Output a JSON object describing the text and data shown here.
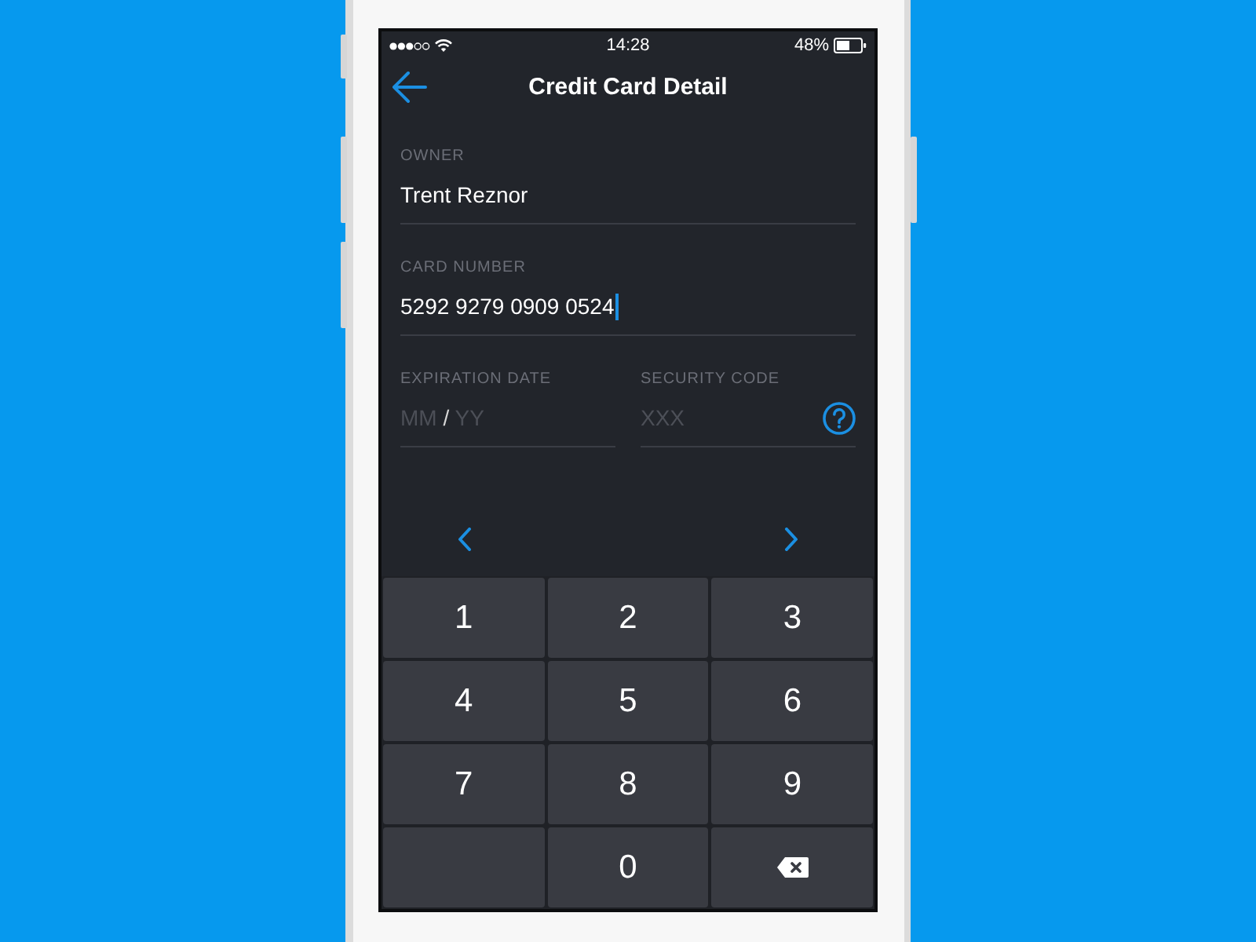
{
  "status_bar": {
    "time": "14:28",
    "battery": "48%"
  },
  "nav_bar": {
    "title": "Credit Card Detail"
  },
  "fields": [
    {
      "label": "OWNER",
      "value": "Trent Reznor",
      "focused": false
    },
    {
      "label": "CARD NUMBER",
      "value": "5292 9279 0909 0524",
      "focused": true
    }
  ],
  "expiration": {
    "label": "EXPIRATION DATE",
    "month_placeholder": "MM",
    "separator": "/",
    "year_placeholder": "YY"
  },
  "security_code": {
    "label": "SECURITY CODE",
    "placeholder": "XXX"
  },
  "keypad": [
    {
      "kind": "digit",
      "label": "1"
    },
    {
      "kind": "digit",
      "label": "2"
    },
    {
      "kind": "digit",
      "label": "3"
    },
    {
      "kind": "digit",
      "label": "4"
    },
    {
      "kind": "digit",
      "label": "5"
    },
    {
      "kind": "digit",
      "label": "6"
    },
    {
      "kind": "digit",
      "label": "7"
    },
    {
      "kind": "digit",
      "label": "8"
    },
    {
      "kind": "digit",
      "label": "9"
    },
    {
      "kind": "blank"
    },
    {
      "kind": "digit",
      "label": "0"
    },
    {
      "kind": "delete"
    }
  ]
}
